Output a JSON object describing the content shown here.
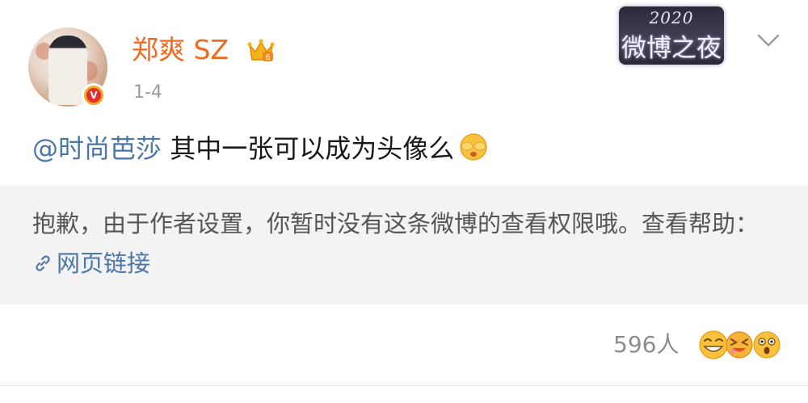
{
  "post": {
    "author": {
      "name": "郑爽 SZ",
      "avatar_icon": "avatar-photo",
      "verified_icon": "verified-v-badge",
      "vip_icon": "crown-level-6-icon",
      "verified_mark": "V"
    },
    "timestamp": "1-4",
    "event_badge": {
      "year": "2020",
      "name": "微博之夜"
    },
    "menu_icon": "chevron-down-icon",
    "mention": "@时尚芭莎",
    "body": " 其中一张可以成为头像么",
    "emoji": "cover-face-emoji"
  },
  "notice": {
    "text": "抱歉，由于作者设置，你暂时没有这条微博的查看权限哦。查看帮助：",
    "link_label": "网页链接",
    "link_icon": "link-icon"
  },
  "footer": {
    "reaction_count": "596人",
    "reaction_emojis": [
      "grin-emoji",
      "laugh-emoji",
      "shocked-emoji"
    ]
  },
  "colors": {
    "username": "#f06b20",
    "link": "#4a76a8",
    "notice_bg": "#f3f3f3"
  }
}
